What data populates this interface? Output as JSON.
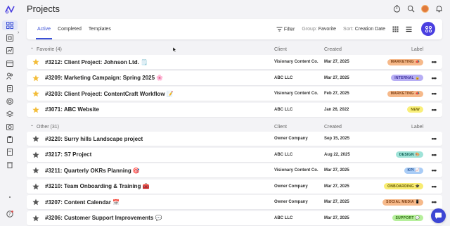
{
  "page": {
    "title": "Projects"
  },
  "toolbar": {
    "tabs": [
      {
        "label": "Active",
        "active": true
      },
      {
        "label": "Completed",
        "active": false
      },
      {
        "label": "Templates",
        "active": false
      }
    ],
    "filter_label": "Filter",
    "group_prefix": "Group:",
    "group_value": "Favorite",
    "sort_prefix": "Sort:",
    "sort_value": "Creation Date"
  },
  "columns": {
    "client": "Client",
    "created": "Created",
    "label": "Label"
  },
  "groups": [
    {
      "title": "Favorite (4)",
      "rows": [
        {
          "name": "#3212: Client Project: Johnson Ltd. 🗒️",
          "client": "Visionary Content Co.",
          "date": "Mar 27, 2025",
          "label": "MARKETING 📣",
          "label_bg": "#f6b98a",
          "label_fg": "#7a3c10",
          "starred": true
        },
        {
          "name": "#3209: Marketing Campaign: Spring 2025 🌸",
          "client": "ABC LLC",
          "date": "Mar 27, 2025",
          "label": "INTERNAL 🔒",
          "label_bg": "#b7aef4",
          "label_fg": "#3b2f9a",
          "starred": true
        },
        {
          "name": "#3203: Client Project: ContentCraft Workflow 📝",
          "client": "Visionary Content Co.",
          "date": "Feb 27, 2025",
          "label": "MARKETING 📣",
          "label_bg": "#f6b98a",
          "label_fg": "#7a3c10",
          "starred": true
        },
        {
          "name": "#3071: ABC Website",
          "client": "ABC LLC",
          "date": "Jan 26, 2022",
          "label": "NEW",
          "label_bg": "#f9ef7a",
          "label_fg": "#6b5e00",
          "starred": true
        }
      ]
    },
    {
      "title": "Other (31)",
      "rows": [
        {
          "name": "#3220: Surry hills Landscape project",
          "client": "Owner Company",
          "date": "Sep 15, 2025",
          "label": "",
          "label_bg": "",
          "label_fg": "",
          "starred": false
        },
        {
          "name": "#3217: S7 Project",
          "client": "ABC LLC",
          "date": "Aug 22, 2025",
          "label": "DESIGN 🎨",
          "label_bg": "#9fe3d8",
          "label_fg": "#0f5e52",
          "starred": false
        },
        {
          "name": "#3211: Quarterly OKRs Planning 🎯",
          "client": "Visionary Content Co.",
          "date": "Mar 27, 2025",
          "label": "KPI 📈",
          "label_bg": "#a9ccf6",
          "label_fg": "#1e4a8a",
          "starred": false
        },
        {
          "name": "#3210: Team Onboarding & Training 🧰",
          "client": "Owner Company",
          "date": "Mar 27, 2025",
          "label": "ONBOARDING 🎓",
          "label_bg": "#f8ec72",
          "label_fg": "#5e5200",
          "starred": false
        },
        {
          "name": "#3207: Content Calendar 📅",
          "client": "Owner Company",
          "date": "Mar 27, 2025",
          "label": "SOCIAL MEDIA 📱",
          "label_bg": "#f6b98a",
          "label_fg": "#7a3c10",
          "starred": false
        },
        {
          "name": "#3206: Customer Support Improvements 💬",
          "client": "ABC LLC",
          "date": "Mar 27, 2025",
          "label": "SUPPORT 💬",
          "label_bg": "#b6ef9c",
          "label_fg": "#2c6a10",
          "starred": false
        }
      ]
    }
  ],
  "colors": {
    "accent": "#3b50d6",
    "fab": "#4a3fe0",
    "star_fav": "#f3bd3a",
    "star_other": "#555555"
  }
}
